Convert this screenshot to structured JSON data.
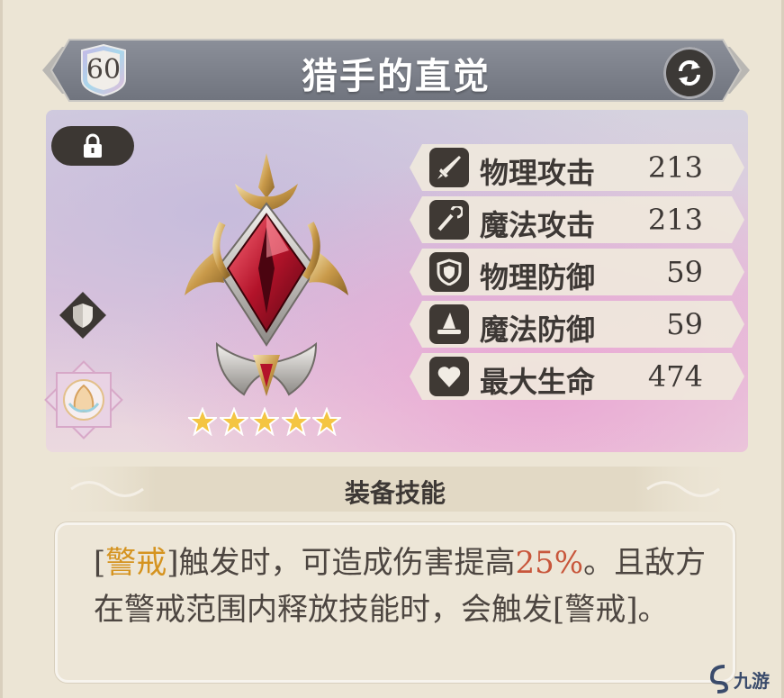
{
  "header": {
    "level": "60",
    "title": "猎手的直觉",
    "refresh_icon": "refresh-icon"
  },
  "showcase": {
    "lock_icon": "lock-icon",
    "shield_icon": "shield-icon",
    "flower_icon": "flower-icon",
    "rarity_stars": 5
  },
  "stats": [
    {
      "label": "物理攻击",
      "value": "213",
      "icon": "sword-icon"
    },
    {
      "label": "魔法攻击",
      "value": "213",
      "icon": "wand-icon"
    },
    {
      "label": "物理防御",
      "value": "59",
      "icon": "shield-icon"
    },
    {
      "label": "魔法防御",
      "value": "59",
      "icon": "wizard-hat-icon"
    },
    {
      "label": "最大生命",
      "value": "474",
      "icon": "heart-icon"
    }
  ],
  "skill": {
    "section_title": "装备技能",
    "desc_open": "[",
    "desc_kw1": "警戒",
    "desc_part1": "]触发时，可造成伤害提高",
    "desc_pct": "25%",
    "desc_part2": "。且敌方在警戒范围内释放技能时，会触发[警戒]。"
  },
  "watermark": "九游",
  "colors": {
    "keyword": "#d5931f",
    "percent": "#c8563b",
    "banner": "#7e838e",
    "dark_button": "#3c3733"
  }
}
